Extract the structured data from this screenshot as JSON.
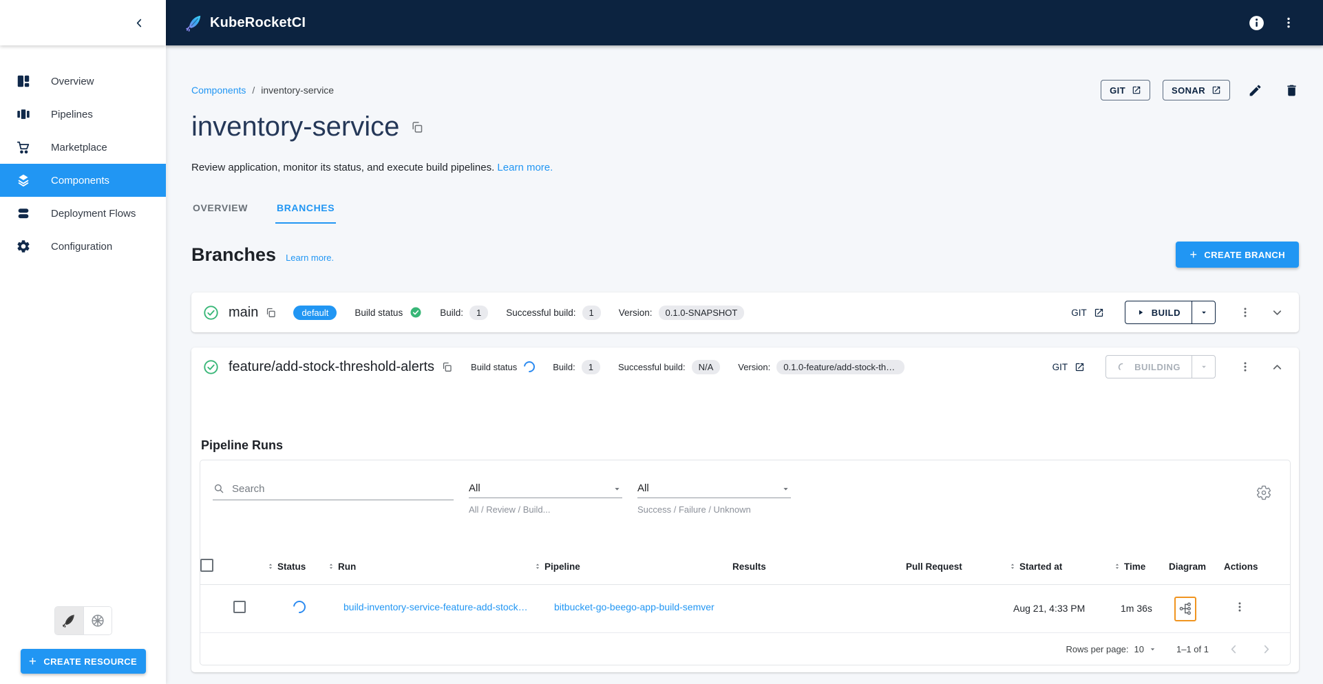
{
  "colors": {
    "accent_blue": "#2196f3",
    "header_navy": "#0c2340",
    "success_green": "#38b677",
    "highlight_orange": "#f0941f",
    "page_background": "#f5f7fa"
  },
  "topbar": {
    "brand": "KubeRocketCI"
  },
  "sidebar": {
    "items": [
      {
        "label": "Overview",
        "active": false
      },
      {
        "label": "Pipelines",
        "active": false
      },
      {
        "label": "Marketplace",
        "active": false
      },
      {
        "label": "Components",
        "active": true
      },
      {
        "label": "Deployment Flows",
        "active": false
      },
      {
        "label": "Configuration",
        "active": false
      }
    ],
    "create_resource_label": "CREATE RESOURCE"
  },
  "page": {
    "breadcrumb": {
      "parent": "Components",
      "separator": "/",
      "current": "inventory-service"
    },
    "actions": {
      "git": "GIT",
      "sonar": "SONAR"
    },
    "title": "inventory-service",
    "description": "Review application, monitor its status, and execute build pipelines.",
    "learn_more": "Learn more.",
    "tabs": [
      {
        "label": "OVERVIEW",
        "active": false
      },
      {
        "label": "BRANCHES",
        "active": true
      }
    ]
  },
  "branches": {
    "heading": "Branches",
    "learn_more": "Learn more.",
    "create_button": "CREATE BRANCH",
    "git_label": "GIT",
    "field_labels": {
      "build_status": "Build status",
      "build": "Build:",
      "successful_build": "Successful build:",
      "version": "Version:"
    },
    "main": {
      "name": "main",
      "chip": "default",
      "status": "success",
      "build_status": "success",
      "build_count": "1",
      "successful_build_count": "1",
      "version": "0.1.0-SNAPSHOT",
      "action_button": "BUILD",
      "expanded": false
    },
    "feature": {
      "name": "feature/add-stock-threshold-alerts",
      "status": "success",
      "build_status": "running",
      "build_count": "1",
      "successful_build_count": "N/A",
      "version": "0.1.0-feature/add-stock-thres…",
      "action_button": "BUILDING",
      "expanded": true
    }
  },
  "pipeline_runs": {
    "heading": "Pipeline Runs",
    "search_placeholder": "Search",
    "filters": [
      {
        "value": "All",
        "helper": "All / Review / Build..."
      },
      {
        "value": "All",
        "helper": "Success / Failure / Unknown"
      }
    ],
    "table": {
      "columns": [
        {
          "label": "Status",
          "sortable": true
        },
        {
          "label": "Run",
          "sortable": true
        },
        {
          "label": "Pipeline",
          "sortable": true
        },
        {
          "label": "Results",
          "sortable": false
        },
        {
          "label": "Pull Request",
          "sortable": false
        },
        {
          "label": "Started at",
          "sortable": true
        },
        {
          "label": "Time",
          "sortable": true
        },
        {
          "label": "Diagram",
          "sortable": false
        },
        {
          "label": "Actions",
          "sortable": false
        }
      ],
      "rows": [
        {
          "status": "running",
          "run": "build-inventory-service-feature-add-stock…",
          "pipeline": "bitbucket-go-beego-app-build-semver",
          "results": "",
          "pull_request": "",
          "started_at": "Aug 21, 4:33 PM",
          "time": "1m 36s"
        }
      ]
    },
    "pagination": {
      "rows_per_page_label": "Rows per page:",
      "rows_per_page_value": "10",
      "range_label": "1–1 of 1"
    }
  }
}
